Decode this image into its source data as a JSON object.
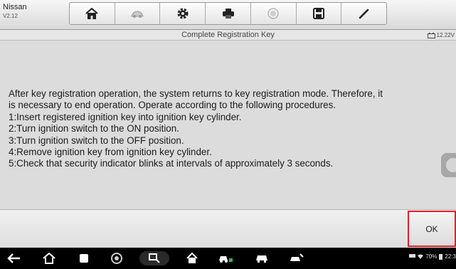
{
  "header": {
    "make": "Nissan",
    "version": "V2.12",
    "toolbar_icons": [
      "home-icon",
      "vehicle-swap-icon",
      "settings-gear-icon",
      "print-icon",
      "help-icon",
      "save-icon",
      "edit-pen-icon"
    ]
  },
  "titlebar": {
    "title": "Complete Registration Key",
    "voltage": "12.22V"
  },
  "message": {
    "text": "After key registration operation, the system returns to key registration mode. Therefore, it\nis necessary to end operation. Operate according to the following procedures.\n1:Insert registered ignition key into ignition key cylinder.\n2:Turn ignition switch to the ON position.\n3:Turn ignition switch to the OFF position.\n4:Remove ignition key from ignition key cylinder.\n5:Check that security indicator blinks at intervals of approximately 3 seconds."
  },
  "actions": {
    "ok_label": "OK"
  },
  "system_nav": {
    "icons": [
      "back-icon",
      "home-icon",
      "recent-apps-icon",
      "chrome-icon",
      "remote-connect-icon",
      "autel-home-icon",
      "car-diagnostic-icon",
      "car-icon",
      "car-service-icon"
    ],
    "status": {
      "battery": "70%",
      "time": "22:3"
    }
  },
  "colors": {
    "highlight": "#e0222a",
    "background": "#dcdcdc",
    "navbar": "#000000"
  }
}
